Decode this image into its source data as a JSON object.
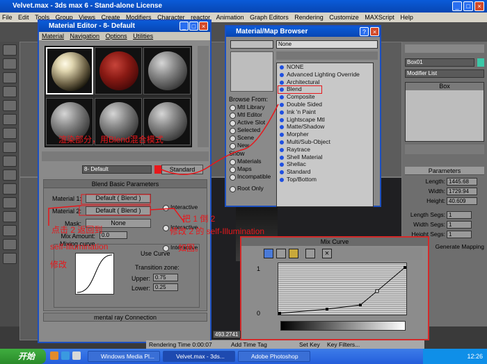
{
  "window": {
    "title": "Velvet.max - 3ds max 6 - Stand-alone License"
  },
  "menu": [
    "File",
    "Edit",
    "Tools",
    "Group",
    "Views",
    "Create",
    "Modifiers",
    "Character",
    "reactor",
    "Animation",
    "Graph Editors",
    "Rendering",
    "Customize",
    "MAXScript",
    "Help"
  ],
  "material_editor": {
    "title": "Material Editor - 8- Default",
    "menu": [
      "Material",
      "Navigation",
      "Options",
      "Utilities"
    ],
    "material_name": "8- Default",
    "material_type": "Standard",
    "blend": {
      "header": "Blend Basic Parameters",
      "material1_label": "Material 1:",
      "material1_value": "Default  ( Blend )",
      "material2_label": "Material 2:",
      "material2_value": "Default  ( Blend )",
      "interactive": "Interactive",
      "mask_label": "Mask:",
      "mask_value": "None",
      "mix_amount_label": "Mix Amount:",
      "mix_amount": "0.0",
      "mixing_curve_label": "Mixing curve",
      "use_curve": "Use Curve",
      "transition_zone": "Transition zone:",
      "upper_label": "Upper:",
      "upper": "0.75",
      "lower_label": "Lower:",
      "lower": "0.25"
    },
    "mental_ray": "mental ray Connection"
  },
  "browser": {
    "title": "Material/Map Browser",
    "search": "None",
    "browse_from_label": "Browse From:",
    "browse_from": [
      "Mtl Library",
      "Mtl Editor",
      "Active Slot",
      "Selected",
      "Scene",
      "New"
    ],
    "show_label": "Show",
    "show": [
      "Materials",
      "Maps",
      "Incompatible"
    ],
    "root_only": "Root Only",
    "items": [
      "NONE",
      "Advanced Lighting Override",
      "Architectural",
      "Blend",
      "Composite",
      "Double Sided",
      "Ink 'n Paint",
      "Lightscape Mtl",
      "Matte/Shadow",
      "Morpher",
      "Multi/Sub-Object",
      "Raytrace",
      "Shell Material",
      "Shellac",
      "Standard",
      "Top/Bottom"
    ]
  },
  "command_panel": {
    "object_name": "Box01",
    "modifier_list": "Modifier List",
    "stack_item": "Box",
    "params_header": "Parameters",
    "length_label": "Length:",
    "length": "1445.68",
    "width_label": "Width:",
    "width": "1729.94",
    "height_label": "Height:",
    "height": "40.609",
    "length_segs_label": "Length Segs:",
    "length_segs": "1",
    "width_segs_label": "Width Segs:",
    "width_segs": "1",
    "height_segs_label": "Height Segs:",
    "height_segs": "1",
    "mapping": "Generate Mapping"
  },
  "mix_curve": {
    "title": "Mix Curve",
    "axis_top": "1",
    "axis_bottom": "0"
  },
  "annotations": {
    "a1": "渲染部分，用Blend混合模式",
    "a2": "点击 2 返回到",
    "a3": "self-Illumination",
    "a4": "修改",
    "a5": "把 1 倒 2",
    "a6": "修改 2 的 self-Illumination",
    "a7": "如图。"
  },
  "status": {
    "rendering": "Rendering Time  0:00:07",
    "add_time_tag": "Add Time Tag",
    "set_key": "Set Key",
    "key_filters": "Key Filters...",
    "coord": "493.2741"
  },
  "taskbar": {
    "start": "开始",
    "tasks": [
      "Windows Media Pl...",
      "Velvet.max - 3ds...",
      "Adobe Photoshop"
    ],
    "clock": "12:26"
  },
  "colors": {
    "title_blue": "#0a5bd8",
    "annotation_red": "#e8171b"
  }
}
